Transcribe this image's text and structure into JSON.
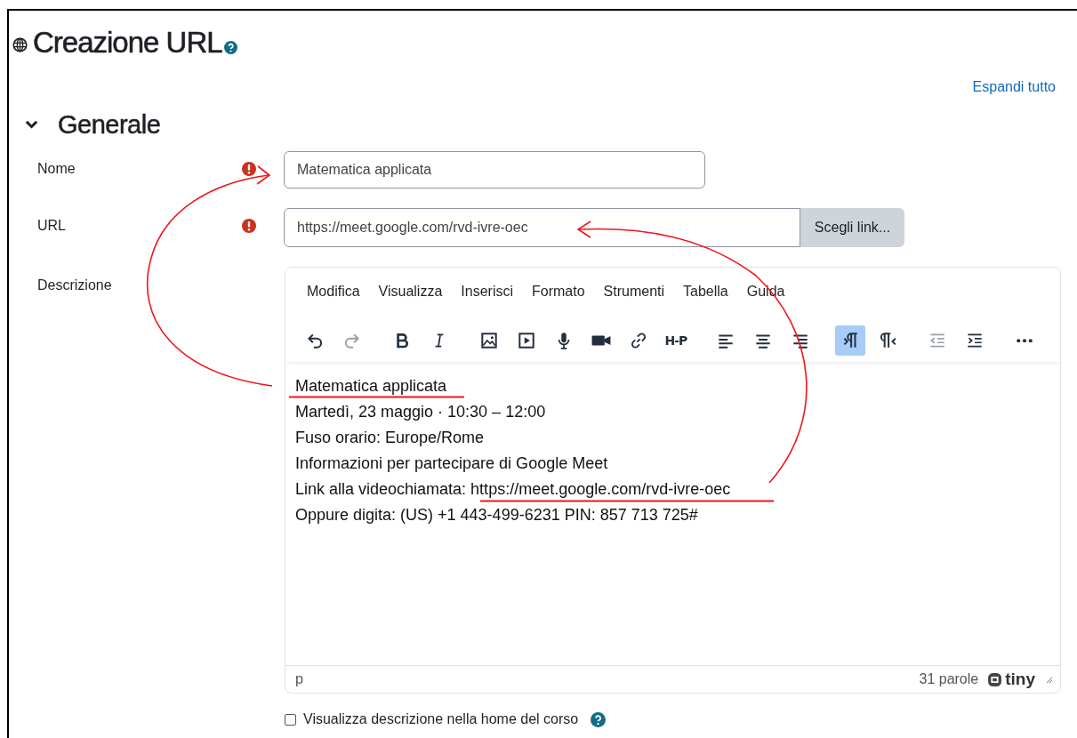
{
  "page": {
    "title": "Creazione URL",
    "expand_link": "Espandi tutto"
  },
  "section": {
    "title": "Generale",
    "expanded": true
  },
  "fields": [
    {
      "label": "Nome",
      "kind": "text",
      "required": true,
      "value": "Matematica applicata"
    },
    {
      "label": "URL",
      "kind": "url",
      "required": true,
      "value": "https://meet.google.com/rvd-ivre-oec",
      "button": "Scegli link..."
    },
    {
      "label": "Descrizione",
      "kind": "editor",
      "required": false
    }
  ],
  "editor": {
    "menu": [
      "Modifica",
      "Visualizza",
      "Inserisci",
      "Formato",
      "Strumenti",
      "Tabella",
      "Guida"
    ],
    "toolbar_groups": [
      [
        {
          "kind": "undo",
          "disabled": false,
          "selected": false
        },
        {
          "kind": "redo",
          "disabled": true,
          "selected": false
        }
      ],
      [
        {
          "kind": "bold",
          "disabled": false,
          "selected": false
        },
        {
          "kind": "italic",
          "disabled": false,
          "selected": false
        }
      ],
      [
        {
          "kind": "image",
          "disabled": false,
          "selected": false
        },
        {
          "kind": "media",
          "disabled": false,
          "selected": false
        },
        {
          "kind": "microphone",
          "disabled": false,
          "selected": false
        },
        {
          "kind": "camera",
          "disabled": false,
          "selected": false
        },
        {
          "kind": "link",
          "disabled": false,
          "selected": false
        },
        {
          "kind": "h5p",
          "label": "H-P",
          "disabled": false,
          "selected": false
        }
      ],
      [
        {
          "kind": "align-left",
          "disabled": false,
          "selected": false
        },
        {
          "kind": "align-center",
          "disabled": false,
          "selected": false
        },
        {
          "kind": "align-right",
          "disabled": false,
          "selected": false
        }
      ],
      [
        {
          "kind": "ltr",
          "disabled": false,
          "selected": true
        },
        {
          "kind": "rtl",
          "disabled": false,
          "selected": false
        }
      ],
      [
        {
          "kind": "outdent",
          "disabled": true,
          "selected": false
        },
        {
          "kind": "indent",
          "disabled": false,
          "selected": false
        }
      ],
      [
        {
          "kind": "more",
          "disabled": false,
          "selected": false
        }
      ]
    ],
    "content": [
      "Matematica applicata",
      "Martedì, 23 maggio · 10:30 – 12:00",
      "Fuso orario: Europe/Rome",
      "Informazioni per partecipare di Google Meet",
      "Link alla videochiamata: https://meet.google.com/rvd-ivre-oec",
      "Oppure digita: (US) +1 443-499-6231 PIN: 857 713 725#"
    ],
    "status_path": "p",
    "word_count": "31 parole",
    "brand": "tiny"
  },
  "checkbox": {
    "label": "Visualizza descrizione nella home del corso",
    "checked": false
  }
}
